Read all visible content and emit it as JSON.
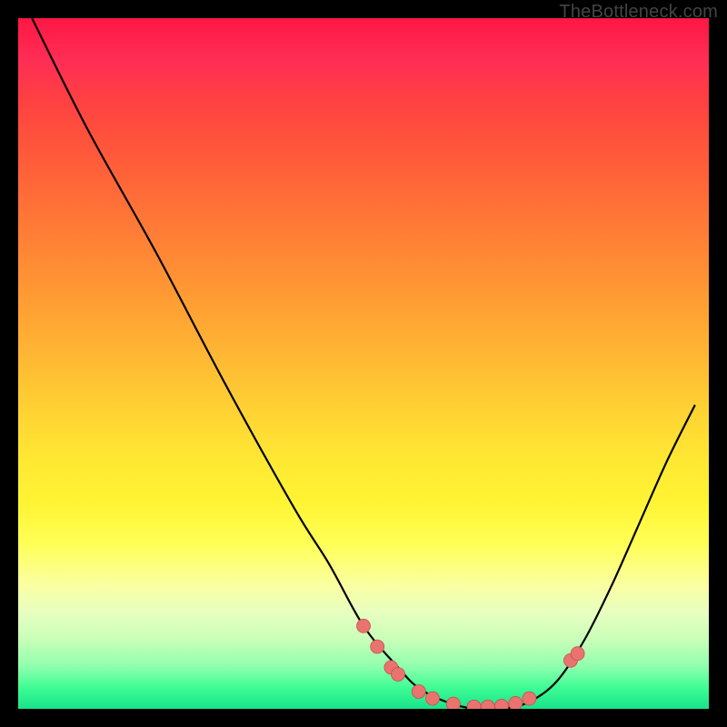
{
  "watermark": "TheBottleneck.com",
  "colors": {
    "frame": "#000000",
    "curve": "#000000",
    "marker_fill": "#e9736f",
    "marker_stroke": "#c94f4b"
  },
  "chart_data": {
    "type": "line",
    "title": "",
    "xlabel": "",
    "ylabel": "",
    "xlim": [
      0,
      100
    ],
    "ylim": [
      0,
      100
    ],
    "grid": false,
    "legend": false,
    "note": "Bottleneck-style curve. y-axis inverted visually (y=100 at top, y=0 at bottom). Values are estimated from pixels; no axis ticks are shown in the image.",
    "series": [
      {
        "name": "bottleneck-curve",
        "x": [
          2,
          10,
          20,
          30,
          40,
          45,
          50,
          55,
          58,
          62,
          66,
          70,
          74,
          78,
          82,
          86,
          90,
          94,
          98
        ],
        "y": [
          100,
          84,
          66,
          47,
          29,
          21,
          12,
          6,
          3,
          1,
          0,
          0,
          1,
          4,
          10,
          18,
          27,
          36,
          44
        ]
      }
    ],
    "markers": {
      "name": "highlighted-points",
      "color": "#e9736f",
      "points": [
        {
          "x": 50,
          "y": 12
        },
        {
          "x": 52,
          "y": 9
        },
        {
          "x": 54,
          "y": 6
        },
        {
          "x": 55,
          "y": 5
        },
        {
          "x": 58,
          "y": 2.5
        },
        {
          "x": 60,
          "y": 1.5
        },
        {
          "x": 63,
          "y": 0.7
        },
        {
          "x": 66,
          "y": 0.3
        },
        {
          "x": 68,
          "y": 0.3
        },
        {
          "x": 70,
          "y": 0.4
        },
        {
          "x": 72,
          "y": 0.8
        },
        {
          "x": 74,
          "y": 1.5
        },
        {
          "x": 80,
          "y": 7
        },
        {
          "x": 81,
          "y": 8
        }
      ]
    }
  }
}
